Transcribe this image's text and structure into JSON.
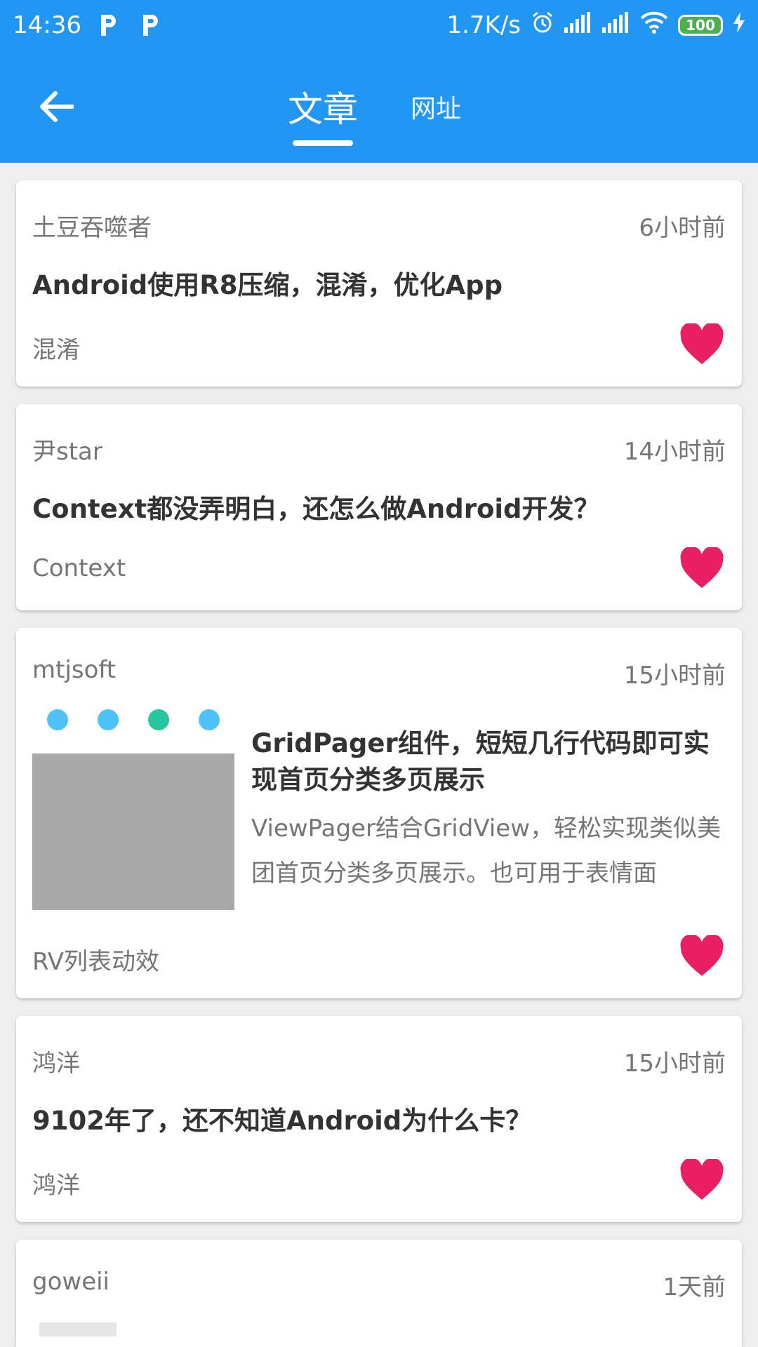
{
  "status_bar": {
    "time": "14:36",
    "net_speed": "1.7K/s",
    "battery": "100"
  },
  "toolbar": {
    "tabs": [
      {
        "label": "文章",
        "active": true
      },
      {
        "label": "网址",
        "active": false
      }
    ]
  },
  "colors": {
    "primary": "#2196f3",
    "heart": "#e91e63",
    "title_text": "#333333",
    "meta_text": "#757575"
  },
  "articles": [
    {
      "author": "土豆吞噬者",
      "time": "6小时前",
      "title": "Android使用R8压缩，混淆，优化App",
      "tag": "混淆",
      "liked": true
    },
    {
      "author": "尹star",
      "time": "14小时前",
      "title": "Context都没弄明白，还怎么做Android开发？",
      "tag": "Context",
      "liked": true
    },
    {
      "author": "mtjsoft",
      "time": "15小时前",
      "title": "GridPager组件，短短几行代码即可实现首页分类多页展示",
      "desc": "ViewPager结合GridView，轻松实现类似美团首页分类多页展示。也可用于表情面",
      "tag": "RV列表动效",
      "liked": true,
      "has_thumbnail": true
    },
    {
      "author": "鸿洋",
      "time": "15小时前",
      "title": "9102年了，还不知道Android为什么卡？",
      "tag": "鸿洋",
      "liked": true
    },
    {
      "author": "goweii",
      "time": "1天前"
    }
  ]
}
